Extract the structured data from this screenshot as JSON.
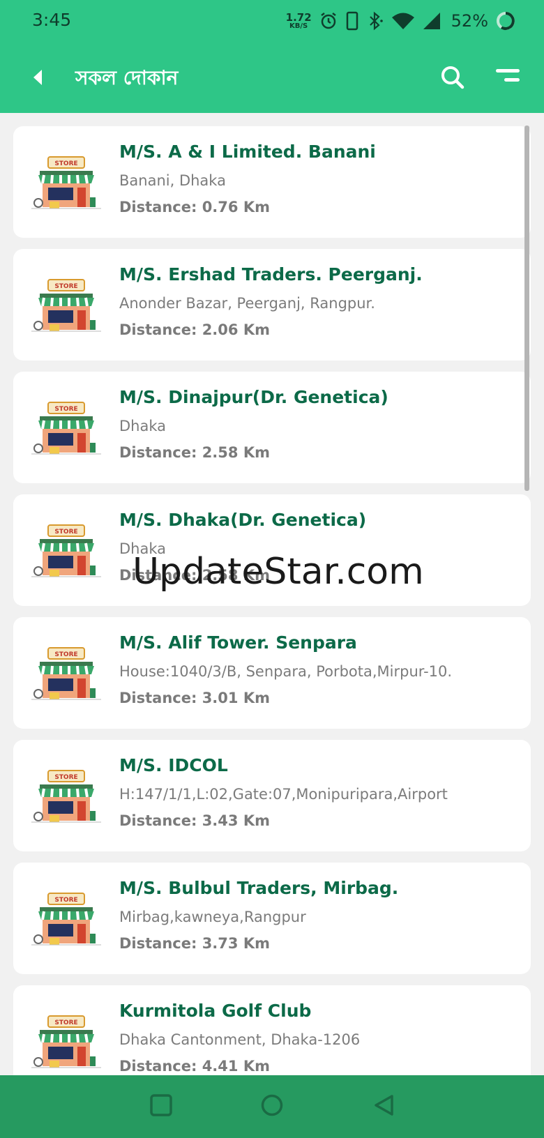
{
  "status": {
    "time": "3:45",
    "speed_value": "1.72",
    "speed_unit": "KB/S",
    "battery": "52%"
  },
  "appbar": {
    "title": "সকল দোকান",
    "back_icon": "back-arrow-icon",
    "search_icon": "search-icon",
    "menu_icon": "sort-menu-icon"
  },
  "colors": {
    "primary": "#2ec687",
    "name_text": "#0c6a48",
    "navbar": "#269a60",
    "background": "#f1f1f1"
  },
  "shops": [
    {
      "name": "M/S. A & I Limited. Banani",
      "address": "Banani, Dhaka",
      "distance": "Distance: 0.76 Km"
    },
    {
      "name": "M/S. Ershad Traders. Peerganj.",
      "address": "Anonder Bazar, Peerganj, Rangpur.",
      "distance": "Distance: 2.06 Km"
    },
    {
      "name": "M/S. Dinajpur(Dr. Genetica)",
      "address": "Dhaka",
      "distance": "Distance: 2.58 Km"
    },
    {
      "name": "M/S. Dhaka(Dr. Genetica)",
      "address": "Dhaka",
      "distance": "Distance: 2.58 Km"
    },
    {
      "name": "M/S. Alif Tower. Senpara",
      "address": "House:1040/3/B, Senpara, Porbota,Mirpur-10.",
      "distance": "Distance: 3.01 Km"
    },
    {
      "name": "M/S. IDCOL",
      "address": "H:147/1/1,L:02,Gate:07,Monipuripara,Airport",
      "distance": "Distance: 3.43 Km"
    },
    {
      "name": "M/S. Bulbul Traders, Mirbag.",
      "address": "Mirbag,kawneya,Rangpur",
      "distance": "Distance: 3.73 Km"
    },
    {
      "name": "Kurmitola Golf Club",
      "address": "Dhaka Cantonment, Dhaka-1206",
      "distance": "Distance: 4.41 Km"
    }
  ],
  "watermark": "UpdateStar.com",
  "navbar": {
    "recents_icon": "square-recents-icon",
    "home_icon": "circle-home-icon",
    "back_icon": "triangle-back-icon"
  }
}
